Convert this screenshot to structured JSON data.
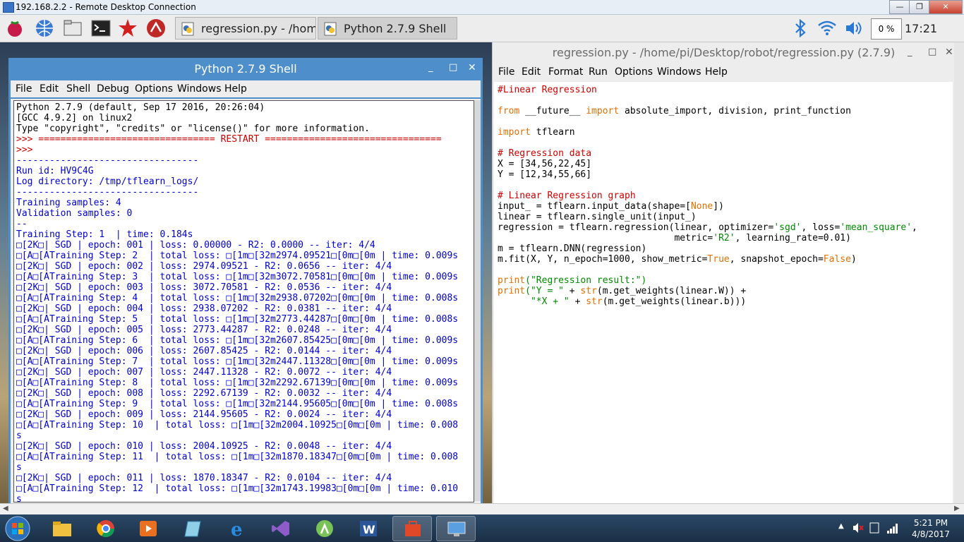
{
  "rdp": {
    "title": "192.168.2.2 - Remote Desktop Connection",
    "min": "—",
    "max": "❐",
    "close": "✕"
  },
  "panel": {
    "tasks": [
      {
        "label": "regression.py - /hom..."
      },
      {
        "label": "Python 2.7.9 Shell"
      }
    ],
    "cpu": "0 %",
    "time": "17:21"
  },
  "shell": {
    "title": "Python 2.7.9 Shell",
    "menu": [
      "File",
      "Edit",
      "Shell",
      "Debug",
      "Options",
      "Windows",
      "Help"
    ],
    "lines": [
      [
        "blk",
        "Python 2.7.9 (default, Sep 17 2016, 20:26:04)"
      ],
      [
        "blk",
        "[GCC 4.9.2] on linux2"
      ],
      [
        "blk",
        "Type \"copyright\", \"credits\" or \"license()\" for more information."
      ],
      [
        "red",
        ">>> ================================ RESTART ================================"
      ],
      [
        "red",
        ">>> "
      ],
      [
        "blu",
        "---------------------------------"
      ],
      [
        "blu",
        "Run id: HV9C4G"
      ],
      [
        "blu",
        "Log directory: /tmp/tflearn_logs/"
      ],
      [
        "blu",
        "---------------------------------"
      ],
      [
        "blu",
        "Training samples: 4"
      ],
      [
        "blu",
        "Validation samples: 0"
      ],
      [
        "blu",
        "--"
      ],
      [
        "blu",
        "Training Step: 1  | time: 0.184s"
      ],
      [
        "blu",
        "□[2K□| SGD | epoch: 001 | loss: 0.00000 - R2: 0.0000 -- iter: 4/4"
      ],
      [
        "blu",
        "□[A□[ATraining Step: 2  | total loss: □[1m□[32m2974.09521□[0m□[0m | time: 0.009s"
      ],
      [
        "blu",
        "□[2K□| SGD | epoch: 002 | loss: 2974.09521 - R2: 0.0656 -- iter: 4/4"
      ],
      [
        "blu",
        "□[A□[ATraining Step: 3  | total loss: □[1m□[32m3072.70581□[0m□[0m | time: 0.009s"
      ],
      [
        "blu",
        "□[2K□| SGD | epoch: 003 | loss: 3072.70581 - R2: 0.0536 -- iter: 4/4"
      ],
      [
        "blu",
        "□[A□[ATraining Step: 4  | total loss: □[1m□[32m2938.07202□[0m□[0m | time: 0.008s"
      ],
      [
        "blu",
        "□[2K□| SGD | epoch: 004 | loss: 2938.07202 - R2: 0.0381 -- iter: 4/4"
      ],
      [
        "blu",
        "□[A□[ATraining Step: 5  | total loss: □[1m□[32m2773.44287□[0m□[0m | time: 0.008s"
      ],
      [
        "blu",
        "□[2K□| SGD | epoch: 005 | loss: 2773.44287 - R2: 0.0248 -- iter: 4/4"
      ],
      [
        "blu",
        "□[A□[ATraining Step: 6  | total loss: □[1m□[32m2607.85425□[0m□[0m | time: 0.009s"
      ],
      [
        "blu",
        "□[2K□| SGD | epoch: 006 | loss: 2607.85425 - R2: 0.0144 -- iter: 4/4"
      ],
      [
        "blu",
        "□[A□[ATraining Step: 7  | total loss: □[1m□[32m2447.11328□[0m□[0m | time: 0.009s"
      ],
      [
        "blu",
        "□[2K□| SGD | epoch: 007 | loss: 2447.11328 - R2: 0.0072 -- iter: 4/4"
      ],
      [
        "blu",
        "□[A□[ATraining Step: 8  | total loss: □[1m□[32m2292.67139□[0m□[0m | time: 0.009s"
      ],
      [
        "blu",
        "□[2K□| SGD | epoch: 008 | loss: 2292.67139 - R2: 0.0032 -- iter: 4/4"
      ],
      [
        "blu",
        "□[A□[ATraining Step: 9  | total loss: □[1m□[32m2144.95605□[0m□[0m | time: 0.008s"
      ],
      [
        "blu",
        "□[2K□| SGD | epoch: 009 | loss: 2144.95605 - R2: 0.0024 -- iter: 4/4"
      ],
      [
        "blu",
        "□[A□[ATraining Step: 10  | total loss: □[1m□[32m2004.10925□[0m□[0m | time: 0.008"
      ],
      [
        "blu",
        "s"
      ],
      [
        "blu",
        "□[2K□| SGD | epoch: 010 | loss: 2004.10925 - R2: 0.0048 -- iter: 4/4"
      ],
      [
        "blu",
        "□[A□[ATraining Step: 11  | total loss: □[1m□[32m1870.18347□[0m□[0m | time: 0.008"
      ],
      [
        "blu",
        "s"
      ],
      [
        "blu",
        "□[2K□| SGD | epoch: 011 | loss: 1870.18347 - R2: 0.0104 -- iter: 4/4"
      ],
      [
        "blu",
        "□[A□[ATraining Step: 12  | total loss: □[1m□[32m1743.19983□[0m□[0m | time: 0.010"
      ],
      [
        "blu",
        "s"
      ]
    ]
  },
  "editor": {
    "title": "regression.py - /home/pi/Desktop/robot/regression.py (2.7.9)",
    "menu": [
      "File",
      "Edit",
      "Format",
      "Run",
      "Options",
      "Windows",
      "Help"
    ],
    "code": [
      [
        [
          "red",
          "#Linear Regression"
        ]
      ],
      [],
      [
        [
          "org",
          "from"
        ],
        [
          "blk",
          " __future__ "
        ],
        [
          "org",
          "import"
        ],
        [
          "blk",
          " absolute_import, division, print_function"
        ]
      ],
      [],
      [
        [
          "org",
          "import"
        ],
        [
          "blk",
          " tflearn"
        ]
      ],
      [],
      [
        [
          "red",
          "# Regression data"
        ]
      ],
      [
        [
          "blk",
          "X = [34,56,22,45]"
        ]
      ],
      [
        [
          "blk",
          "Y = [12,34,55,66]"
        ]
      ],
      [],
      [
        [
          "red",
          "# Linear Regression graph"
        ]
      ],
      [
        [
          "blk",
          "input_ = tflearn.input_data(shape=["
        ],
        [
          "org",
          "None"
        ],
        [
          "blk",
          "])"
        ]
      ],
      [
        [
          "blk",
          "linear = tflearn.single_unit(input_)"
        ]
      ],
      [
        [
          "blk",
          "regression = tflearn.regression(linear, optimizer="
        ],
        [
          "grn",
          "'sgd'"
        ],
        [
          "blk",
          ", loss="
        ],
        [
          "grn",
          "'mean_square'"
        ],
        [
          "blk",
          ","
        ]
      ],
      [
        [
          "blk",
          "                                metric="
        ],
        [
          "grn",
          "'R2'"
        ],
        [
          "blk",
          ", learning_rate=0.01)"
        ]
      ],
      [
        [
          "blk",
          "m = tflearn.DNN(regression)"
        ]
      ],
      [
        [
          "blk",
          "m.fit(X, Y, n_epoch=1000, show_metric="
        ],
        [
          "org",
          "True"
        ],
        [
          "blk",
          ", snapshot_epoch="
        ],
        [
          "org",
          "False"
        ],
        [
          "blk",
          ")"
        ]
      ],
      [],
      [
        [
          "org",
          "print"
        ],
        [
          "grn",
          "(\"Regression result:\")"
        ]
      ],
      [
        [
          "org",
          "print"
        ],
        [
          "grn",
          "(\"Y = \""
        ],
        [
          "blk",
          " + "
        ],
        [
          "org",
          "str"
        ],
        [
          "blk",
          "(m.get_weights(linear.W)) +"
        ]
      ],
      [
        [
          "grn",
          "      \"*X + \""
        ],
        [
          "blk",
          " + "
        ],
        [
          "org",
          "str"
        ],
        [
          "blk",
          "(m.get_weights(linear.b)))"
        ]
      ]
    ]
  },
  "taskbar": {
    "time": "5:21 PM",
    "date": "4/8/2017"
  },
  "colors": {
    "shell_title": "#4e8ecb",
    "panel": "#ededed",
    "taskbar": "#1b2f46"
  }
}
